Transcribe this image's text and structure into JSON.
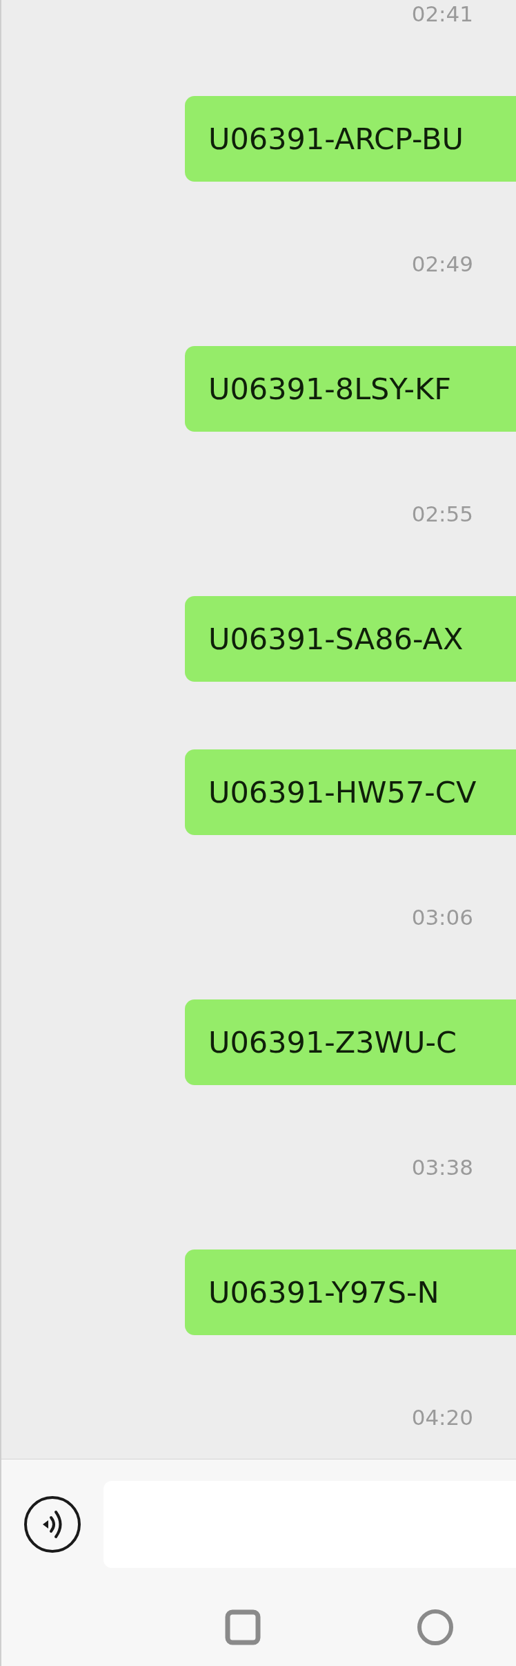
{
  "chat": [
    {
      "kind": "time",
      "text": "02:41"
    },
    {
      "kind": "message",
      "text": "U06391-ARCP-BU"
    },
    {
      "kind": "time",
      "text": "02:49"
    },
    {
      "kind": "message",
      "text": "U06391-8LSY-KF"
    },
    {
      "kind": "time",
      "text": "02:55"
    },
    {
      "kind": "message",
      "text": "U06391-SA86-AX"
    },
    {
      "kind": "message",
      "text": "U06391-HW57-CV"
    },
    {
      "kind": "time",
      "text": "03:06"
    },
    {
      "kind": "message",
      "text": "U06391-Z3WU-C"
    },
    {
      "kind": "time",
      "text": "03:38"
    },
    {
      "kind": "message",
      "text": "U06391-Y97S-N"
    },
    {
      "kind": "time",
      "text": "04:20"
    }
  ]
}
